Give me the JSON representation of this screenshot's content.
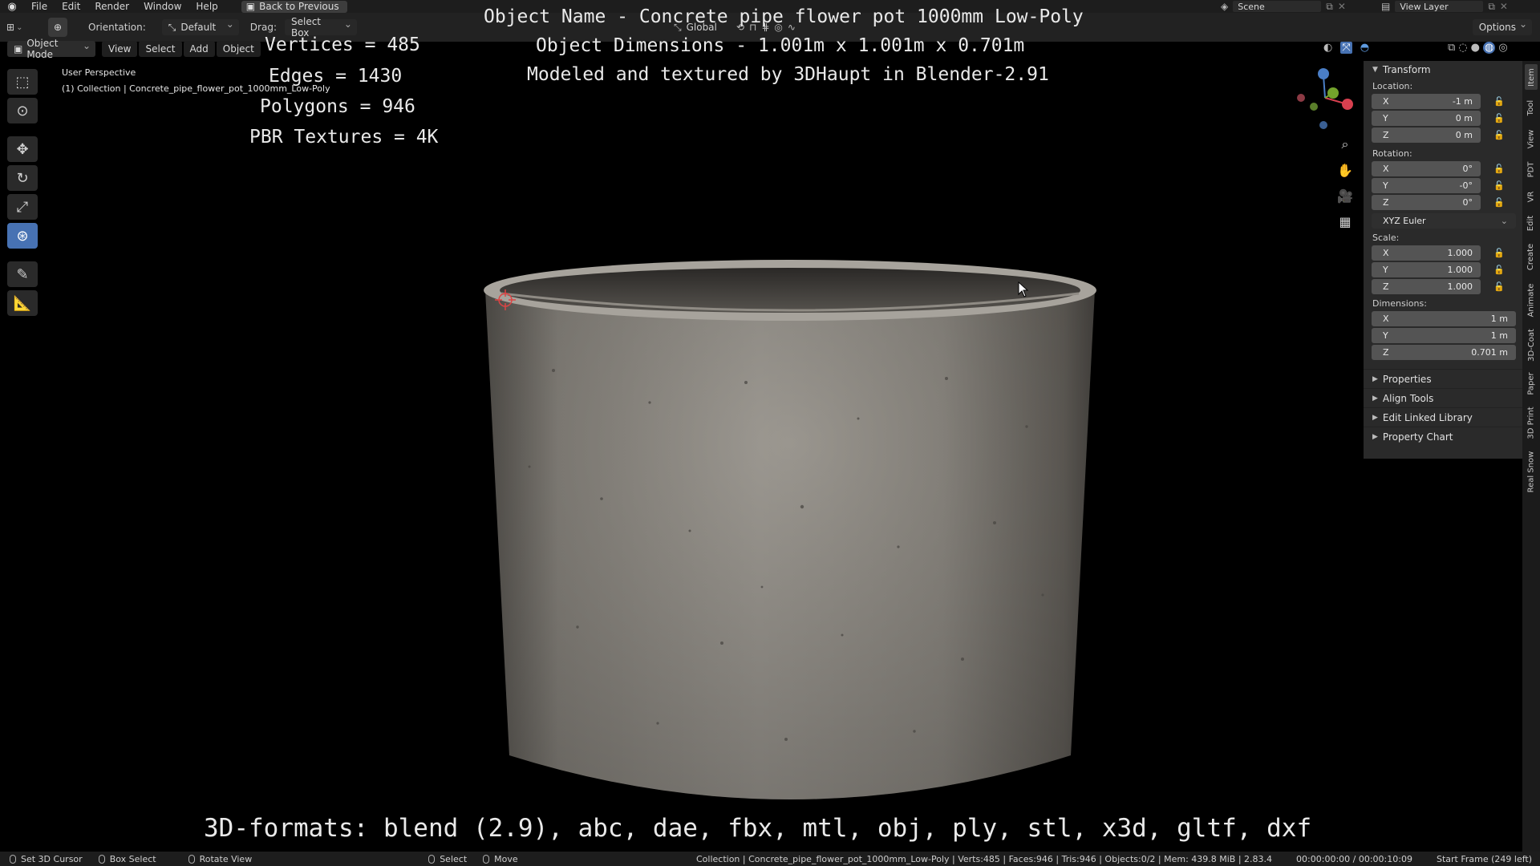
{
  "topbar": {
    "menus": [
      "File",
      "Edit",
      "Render",
      "Window",
      "Help"
    ],
    "back_button": "Back to Previous",
    "scene": "Scene",
    "view_layer": "View Layer"
  },
  "toolheader": {
    "orientation_label": "Orientation:",
    "orientation_value": "Default",
    "drag_label": "Drag:",
    "drag_value": "Select Box",
    "transform_space": "Global",
    "options": "Options"
  },
  "viewport_header": {
    "mode": "Object Mode",
    "menus": [
      "View",
      "Select",
      "Add",
      "Object"
    ]
  },
  "viewport": {
    "perspective": "User Perspective",
    "collection_info": "(1) Collection | Concrete_pipe_flower_pot_1000mm_Low-Poly"
  },
  "overlay": {
    "title": "Object Name - Concrete pipe flower pot 1000mm Low-Poly",
    "dimensions": "Object Dimensions -  1.001m x 1.001m x 0.701m",
    "modeled_by": "Modeled and textured by 3DHaupt in Blender-2.91",
    "vertices": "Vertices = 485",
    "edges": "Edges = 1430",
    "polygons": "Polygons = 946",
    "pbr": "PBR Textures = 4K",
    "formats": "3D-formats: blend (2.9), abc, dae, fbx, mtl, obj, ply, stl, x3d, gltf, dxf"
  },
  "npanel": {
    "transform_title": "Transform",
    "location_label": "Location:",
    "location": [
      {
        "axis": "X",
        "value": "-1 m"
      },
      {
        "axis": "Y",
        "value": "0 m"
      },
      {
        "axis": "Z",
        "value": "0 m"
      }
    ],
    "rotation_label": "Rotation:",
    "rotation": [
      {
        "axis": "X",
        "value": "0°"
      },
      {
        "axis": "Y",
        "value": "-0°"
      },
      {
        "axis": "Z",
        "value": "0°"
      }
    ],
    "rotation_mode": "XYZ Euler",
    "scale_label": "Scale:",
    "scale": [
      {
        "axis": "X",
        "value": "1.000"
      },
      {
        "axis": "Y",
        "value": "1.000"
      },
      {
        "axis": "Z",
        "value": "1.000"
      }
    ],
    "dimensions_label": "Dimensions:",
    "dimensions": [
      {
        "axis": "X",
        "value": "1 m"
      },
      {
        "axis": "Y",
        "value": "1 m"
      },
      {
        "axis": "Z",
        "value": "0.701 m"
      }
    ],
    "collapsed_sections": [
      "Properties",
      "Align Tools",
      "Edit Linked Library",
      "Property Chart"
    ]
  },
  "vtabs": [
    "Item",
    "Tool",
    "View",
    "PDT",
    "VR",
    "Edit",
    "Create",
    "Animate",
    "3D-Coat",
    "Paper",
    "3D Print",
    "Real Snow"
  ],
  "statusbar": {
    "set_cursor": "Set 3D Cursor",
    "box_select": "Box Select",
    "rotate_view": "Rotate View",
    "select": "Select",
    "move": "Move",
    "stats": "Collection | Concrete_pipe_flower_pot_1000mm_Low-Poly | Verts:485 | Faces:946 | Tris:946 | Objects:0/2 | Mem: 439.8 MiB | 2.83.4",
    "time": "00:00:00:00 / 00:00:10:09",
    "start_frame": "Start Frame (249 left)"
  }
}
